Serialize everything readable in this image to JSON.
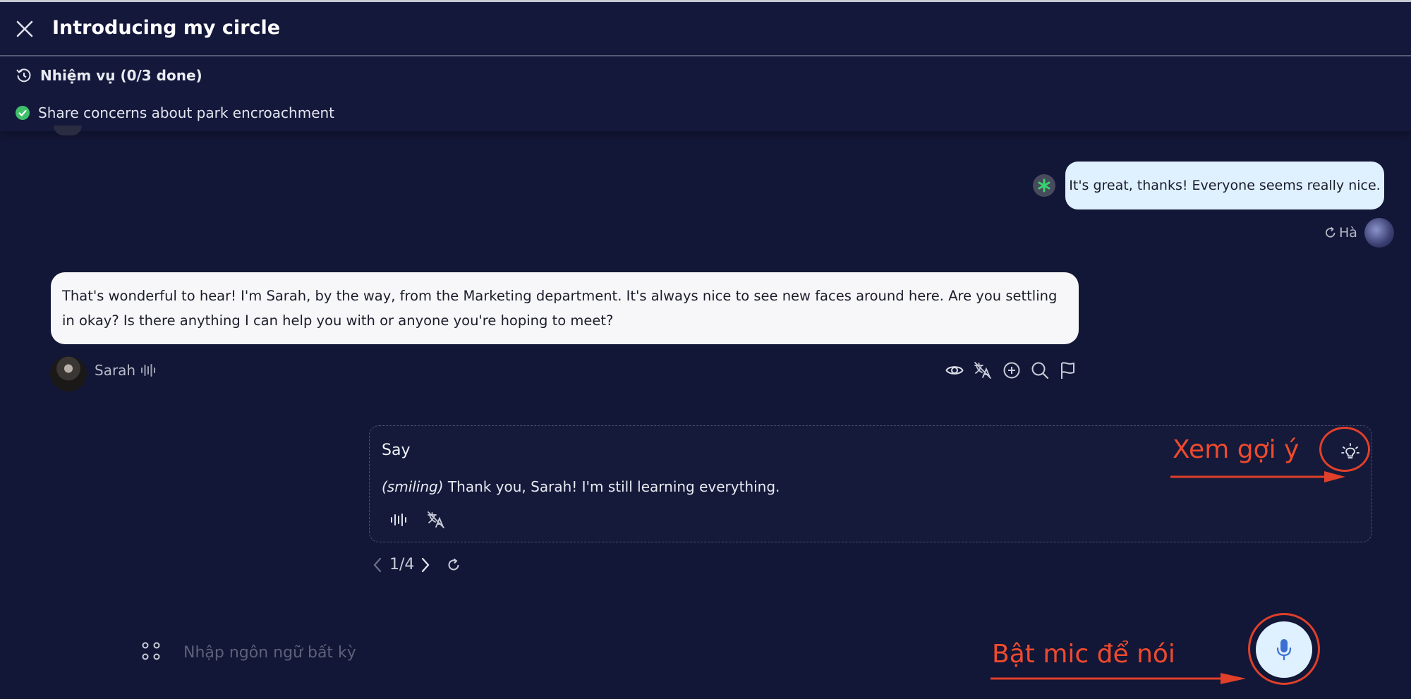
{
  "header": {
    "title": "Introducing my circle"
  },
  "mission": {
    "title": "Nhiệm vụ (0/3 done)",
    "task": "Share concerns about park encroachment"
  },
  "messages": {
    "user": {
      "text": "It's great, thanks! Everyone seems really nice.",
      "name": "Hà"
    },
    "sarah": {
      "text": "That's wonderful to hear! I'm Sarah, by the way, from the Marketing department. It's always nice to see new faces around here. Are you settling in okay? Is there anything I can help you with or anyone you're hoping to meet?",
      "name": "Sarah"
    }
  },
  "suggestion_card": {
    "label": "Say",
    "emotion": "(smiling)",
    "text": "Thank you, Sarah! I'm still learning everything.",
    "pager": "1/4"
  },
  "annotations": {
    "hint": "Xem gợi ý",
    "mic": "Bật mic để nói"
  },
  "input": {
    "placeholder": "Nhập ngôn ngữ bất kỳ"
  },
  "colors": {
    "background": "#131737",
    "user_bubble": "#dff0ff",
    "sarah_bubble": "#f7f7f9",
    "annotation_red": "#ee4a2e",
    "success_green": "#3fbf6a"
  },
  "icons": [
    "close-icon",
    "history-icon",
    "check-circle-icon",
    "asterisk-icon",
    "refresh-icon",
    "audio-wave-icon",
    "eye-icon",
    "no-translate-icon",
    "plus-circle-icon",
    "search-icon",
    "flag-icon",
    "lightbulb-icon",
    "chevron-left-icon",
    "chevron-right-icon",
    "apps-icon",
    "microphone-icon"
  ]
}
